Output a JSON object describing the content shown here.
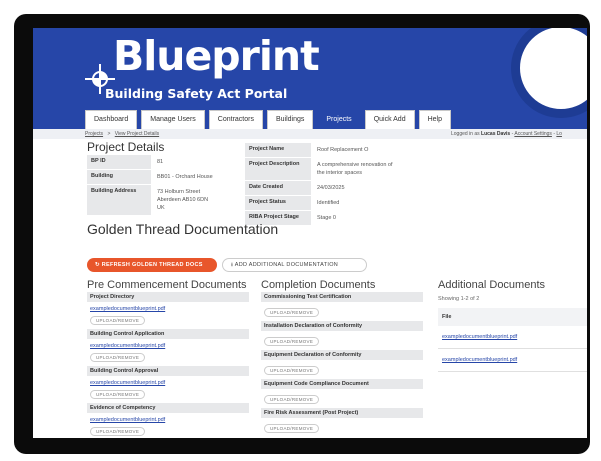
{
  "brand": {
    "name": "Blueprint",
    "subtitle": "Building Safety Act Portal"
  },
  "nav": {
    "tabs": [
      {
        "label": "Dashboard"
      },
      {
        "label": "Manage Users"
      },
      {
        "label": "Contractors"
      },
      {
        "label": "Buildings"
      },
      {
        "label": "Projects",
        "active": true
      },
      {
        "label": "Quick Add"
      },
      {
        "label": "Help"
      }
    ]
  },
  "breadcrumb": {
    "items": [
      "Projects",
      "View Project Details"
    ],
    "separator": ">"
  },
  "user": {
    "prefix": "Logged in as",
    "name": "Lucas Davis",
    "settings": "Account Settings",
    "logout": "Lo"
  },
  "project": {
    "title": "Project Details",
    "left": [
      {
        "label": "BP ID",
        "value": "81"
      },
      {
        "label": "Building",
        "value": "BB01 - Orchard House"
      },
      {
        "label": "Building Address",
        "value": "73 Holburn Street\nAberdeen AB10 6DN\nUK"
      }
    ],
    "right": [
      {
        "label": "Project Name",
        "value": "Roof Replacement O"
      },
      {
        "label": "Project Description",
        "value": "A comprehensive renovation of\nthe interior spaces"
      },
      {
        "label": "Date Created",
        "value": "24/03/2025"
      },
      {
        "label": "Project Status",
        "value": "Identified"
      },
      {
        "label": "RIBA Project Stage",
        "value": "Stage 0"
      }
    ]
  },
  "golden_thread": {
    "title": "Golden Thread Documentation",
    "refresh_label": "REFRESH GOLDEN THREAD DOCS",
    "add_label": "ADD ADDITIONAL DOCUMENTATION"
  },
  "pre_commencement": {
    "title": "Pre Commencement Documents",
    "sections": [
      {
        "name": "Project Directory",
        "file": "exampledocumentblueprint.pdf",
        "action": "UPLOAD/REMOVE"
      },
      {
        "name": "Building Control Application",
        "file": "exampledocumentblueprint.pdf",
        "action": "UPLOAD/REMOVE"
      },
      {
        "name": "Building Control Approval",
        "file": "exampledocumentblueprint.pdf",
        "action": "UPLOAD/REMOVE"
      },
      {
        "name": "Evidence of Competency",
        "file": "exampledocumentblueprint.pdf",
        "action": "UPLOAD/REMOVE"
      }
    ]
  },
  "completion": {
    "title": "Completion Documents",
    "sections": [
      {
        "name": "Commissioning Test Certification",
        "action": "UPLOAD/REMOVE"
      },
      {
        "name": "Installation Declaration of Conformity",
        "action": "UPLOAD/REMOVE"
      },
      {
        "name": "Equipment Declaration of Conformity",
        "action": "UPLOAD/REMOVE"
      },
      {
        "name": "Equipment Code Compliance Document",
        "action": "UPLOAD/REMOVE"
      },
      {
        "name": "Fire Risk Assessment (Post Project)",
        "action": "UPLOAD/REMOVE"
      }
    ]
  },
  "additional": {
    "title": "Additional Documents",
    "showing": "Showing 1-2 of 2",
    "column": "File",
    "rows": [
      "exampledocumentblueprint.pdf",
      "exampledocumentblueprint.pdf"
    ]
  },
  "colors": {
    "header_blue": "#2646a8",
    "orange": "#e8562b",
    "badge_ring": "#1e3c94"
  },
  "icons": {
    "logo": "blueprint-logo-mark",
    "add": "upload-icon"
  }
}
